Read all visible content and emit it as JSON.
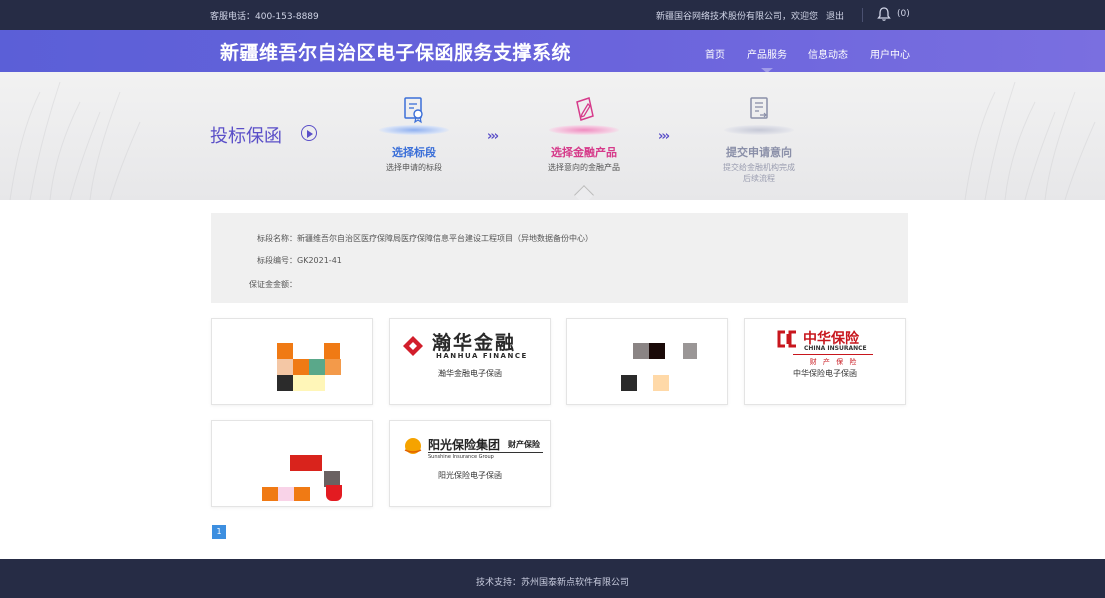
{
  "topbar": {
    "phone": "客服电话：400-153-8889",
    "company": "新疆国谷网络技术股份有限公司，欢迎您",
    "logout": "退出",
    "notification_count": "(0)"
  },
  "header": {
    "title": "新疆维吾尔自治区电子保函服务支撑系统",
    "nav": [
      "首页",
      "产品服务",
      "信息动态",
      "用户中心"
    ],
    "active_nav": "产品服务"
  },
  "hero": {
    "page_title": "投标保函",
    "steps": [
      {
        "name": "选择标段",
        "desc": "选择申请的标段",
        "icon": "document-stamp-icon",
        "color": "#3b6fd8"
      },
      {
        "name": "选择金融产品",
        "desc": "选择意向的金融产品",
        "icon": "pen-edit-icon",
        "color": "#d63a8a"
      },
      {
        "name": "提交申请意向",
        "desc": "提交给金融机构完成后续流程",
        "icon": "checklist-icon",
        "color": "#8a8fa8"
      }
    ],
    "separator": "›››"
  },
  "info": {
    "section_name": "标段名称：新疆维吾尔自治区医疗保障局医疗保障信息平台建设工程项目（异地数据备份中心）",
    "section_code": "标段编号：GK2021-41",
    "amount_label": "保证金金额："
  },
  "products": [
    {
      "caption": "",
      "logo": "pixelated-logo"
    },
    {
      "caption": "瀚华金融电子保函",
      "logo": "hanhua-finance-logo",
      "logo_title": "瀚华金融",
      "logo_sub": "HANHUA FINANCE"
    },
    {
      "caption": "",
      "logo": "pixelated-logo"
    },
    {
      "caption": "中华保险电子保函",
      "logo": "china-insurance-logo",
      "logo_title": "中华保险",
      "logo_sub": "CHINA INSURANCE",
      "logo_sub2": "财 产 保 险"
    },
    {
      "caption": "",
      "logo": "pixelated-logo"
    },
    {
      "caption": "阳光保险电子保函",
      "logo": "sunshine-insurance-logo",
      "logo_title": "阳光保险集团",
      "logo_side": "财产保险",
      "logo_sub": "Sunshine Insurance Group"
    }
  ],
  "pager": {
    "current": "1"
  },
  "footer": {
    "text": "技术支持：苏州国泰新点软件有限公司"
  },
  "colors": {
    "topbar": "#262c45",
    "header": "#5b5fd7",
    "accent": "#5a4fc8",
    "pager": "#3d8fe0"
  }
}
